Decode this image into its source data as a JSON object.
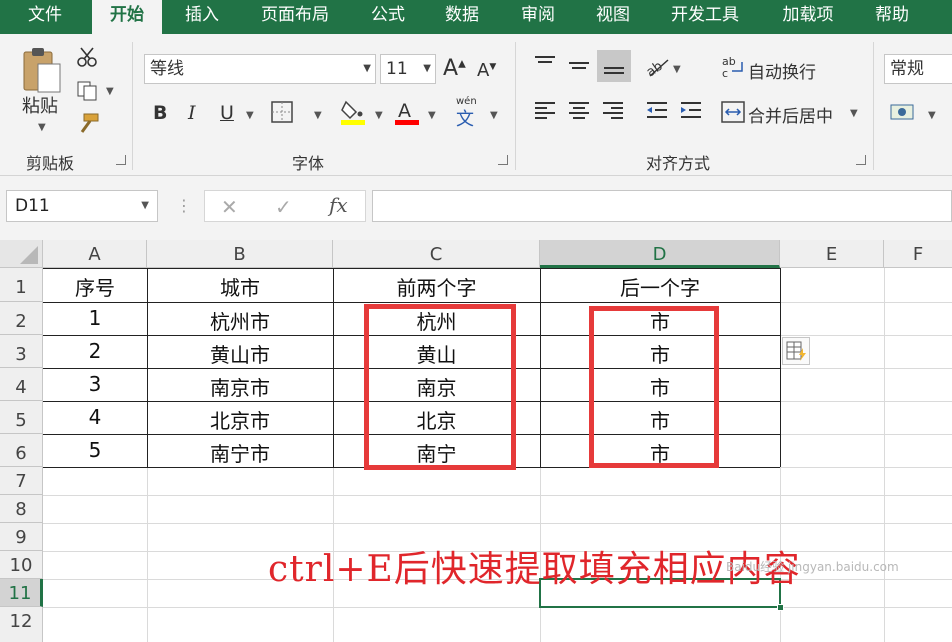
{
  "ribbon_tabs": [
    "文件",
    "开始",
    "插入",
    "页面布局",
    "公式",
    "数据",
    "审阅",
    "视图",
    "开发工具",
    "加载项",
    "帮助"
  ],
  "clipboard": {
    "paste_label": "粘贴",
    "group_label": "剪贴板"
  },
  "font": {
    "name": "等线",
    "size": "11",
    "group_label": "字体",
    "bold": "B",
    "italic": "I",
    "underline": "U",
    "phonetic": "wén"
  },
  "alignment": {
    "wrap_label": "自动换行",
    "merge_label": "合并后居中",
    "group_label": "对齐方式"
  },
  "number": {
    "format": "常规"
  },
  "formula_bar": {
    "name_box": "D11",
    "fx": "fx",
    "formula": ""
  },
  "columns": [
    "A",
    "B",
    "C",
    "D",
    "E",
    "F"
  ],
  "rows": [
    "1",
    "2",
    "3",
    "4",
    "5",
    "6",
    "7",
    "8",
    "9",
    "10",
    "11",
    "12"
  ],
  "table": {
    "headers": [
      "序号",
      "城市",
      "前两个字",
      "后一个字"
    ],
    "rows": [
      [
        "1",
        "杭州市",
        "杭州",
        "市"
      ],
      [
        "2",
        "黄山市",
        "黄山",
        "市"
      ],
      [
        "3",
        "南京市",
        "南京",
        "市"
      ],
      [
        "4",
        "北京市",
        "北京",
        "市"
      ],
      [
        "5",
        "南宁市",
        "南宁",
        "市"
      ]
    ]
  },
  "caption": "ctrl+E后快速提取填充相应内容",
  "watermark": "Baidu经验  jingyan.baidu.com",
  "colors": {
    "accent": "#217346",
    "highlight_box": "#e63a3a",
    "caption": "#e0262b",
    "fill_yellow": "#ffff00",
    "font_red": "#ff0000"
  },
  "icons": [
    "paste-icon",
    "cut-icon",
    "copy-icon",
    "format-painter-icon",
    "increase-font-icon",
    "decrease-font-icon",
    "border-icon",
    "fill-color-icon",
    "font-color-icon",
    "phonetic-icon",
    "align-top-icon",
    "align-middle-icon",
    "align-bottom-icon",
    "orientation-icon",
    "align-left-icon",
    "align-center-icon",
    "align-right-icon",
    "decrease-indent-icon",
    "increase-indent-icon",
    "wrap-text-icon",
    "merge-center-icon",
    "currency-icon",
    "cancel-icon",
    "enter-icon",
    "function-icon",
    "flash-fill-options-icon"
  ]
}
